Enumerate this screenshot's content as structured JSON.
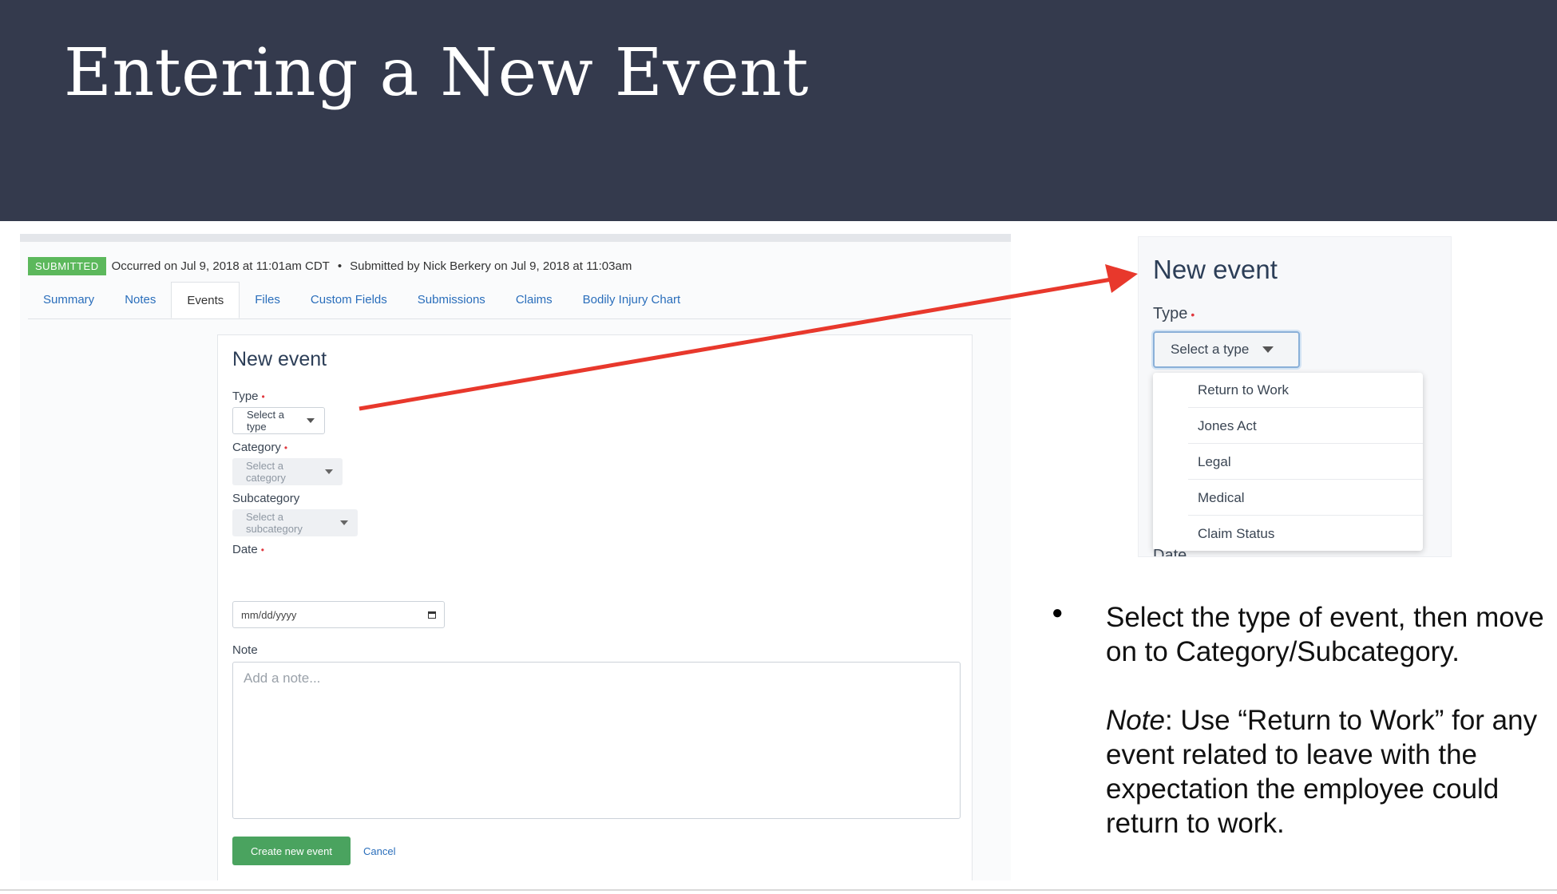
{
  "slide": {
    "title": "Entering a New Event"
  },
  "screenshot": {
    "status_badge": "SUBMITTED",
    "occurred_text": "Occurred on Jul 9, 2018 at 11:01am CDT",
    "separator": "•",
    "submitted_text": "Submitted by Nick Berkery on Jul 9, 2018 at 11:03am",
    "tabs": [
      {
        "label": "Summary",
        "active": false
      },
      {
        "label": "Notes",
        "active": false
      },
      {
        "label": "Events",
        "active": true
      },
      {
        "label": "Files",
        "active": false
      },
      {
        "label": "Custom Fields",
        "active": false
      },
      {
        "label": "Submissions",
        "active": false
      },
      {
        "label": "Claims",
        "active": false
      },
      {
        "label": "Bodily Injury Chart",
        "active": false
      }
    ],
    "form": {
      "title": "New event",
      "type_label": "Type",
      "type_placeholder": "Select a type",
      "category_label": "Category",
      "category_placeholder": "Select a category",
      "subcategory_label": "Subcategory",
      "subcategory_placeholder": "Select a subcategory",
      "date_label": "Date",
      "date_placeholder": "mm/dd/yyyy",
      "note_label": "Note",
      "note_placeholder": "Add a note...",
      "required_marker": "•",
      "create_button": "Create new event",
      "cancel_button": "Cancel"
    }
  },
  "zoom_panel": {
    "title": "New event",
    "type_label": "Type",
    "type_placeholder": "Select a type",
    "options": [
      "Return to Work",
      "Jones Act",
      "Legal",
      "Medical",
      "Claim Status"
    ],
    "cut_off_label": "Date"
  },
  "instructions": {
    "bullet_symbol": "●",
    "main": "Select the type of event, then move on to Category/Subcategory.",
    "note_prefix": "Note",
    "note_body": ": Use “Return to Work” for any event related to leave with the expectation the employee could return to work."
  },
  "colors": {
    "title_bar": "#343a4d",
    "badge": "#5cb85c",
    "link": "#2a6ebb",
    "create_button": "#4aa35f",
    "arrow": "#e8382c",
    "required": "#e0383f"
  }
}
